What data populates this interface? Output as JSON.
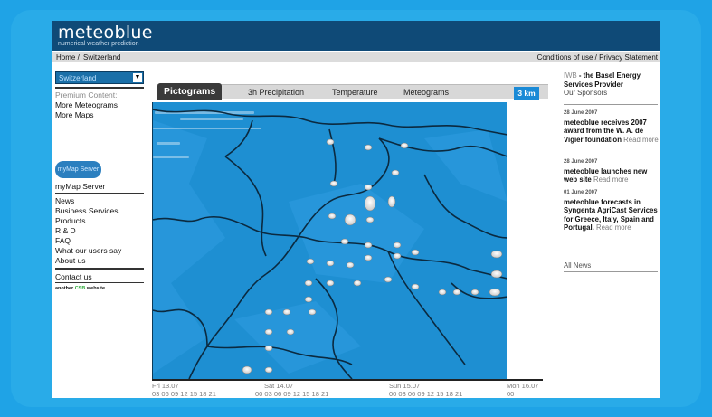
{
  "header": {
    "logo": "meteoblue",
    "tagline": "numerical weather prediction"
  },
  "breadcrumb": {
    "home": "Home /",
    "current": "Switzerland"
  },
  "legal": "Conditions of use / Privacy Statement",
  "sidebar": {
    "region_select": "Switzerland",
    "premium_label": "Premium Content:",
    "more_meteograms": "More Meteograms",
    "more_maps": "More Maps",
    "mymap_button": "myMap Server",
    "mymap_link": "myMap Server",
    "nav": [
      "News",
      "Business Services",
      "Products",
      "R & D",
      "FAQ",
      "What our users say",
      "About us"
    ],
    "contact": "Contact us",
    "another_prefix": "another",
    "another_brand": "CSB",
    "another_suffix": "website"
  },
  "tabs": [
    "Pictograms",
    "3h Precipitation",
    "Temperature",
    "Meteograms"
  ],
  "resolution_badge": "3 km",
  "timebar": {
    "days": [
      "Fri 13.07",
      "Sat 14.07",
      "Sun 15.07",
      "Mon 16.07"
    ],
    "hours_fri": "03 06 09 12 15 18 21",
    "hours_sat": "00 03 06 09 12 15 18 21",
    "hours_sun": "00 03 06 09 12 15 18 21",
    "hours_mon": "00"
  },
  "news": {
    "sponsor_a": "IWB",
    "sponsor_b": " - the Basel Energy Services Provider",
    "sponsors_link": "Our Sponsors",
    "items": [
      {
        "date": "28 June 2007",
        "title": "meteoblue receives 2007 award from the W. A. de Vigier foundation",
        "more": "Read more"
      },
      {
        "date": "28 June 2007",
        "title": "meteoblue launches new web site",
        "more": "Read more"
      },
      {
        "date": "01 June 2007",
        "title": "meteoblue forecasts in Syngenta AgriCast Services for Greece, Italy, Spain and Portugal.",
        "more": "Read more"
      }
    ],
    "all_news": "All News"
  },
  "colors": {
    "header": "#0f4a77",
    "map_water": "#1e8fd2",
    "frame": "#29abe8"
  }
}
